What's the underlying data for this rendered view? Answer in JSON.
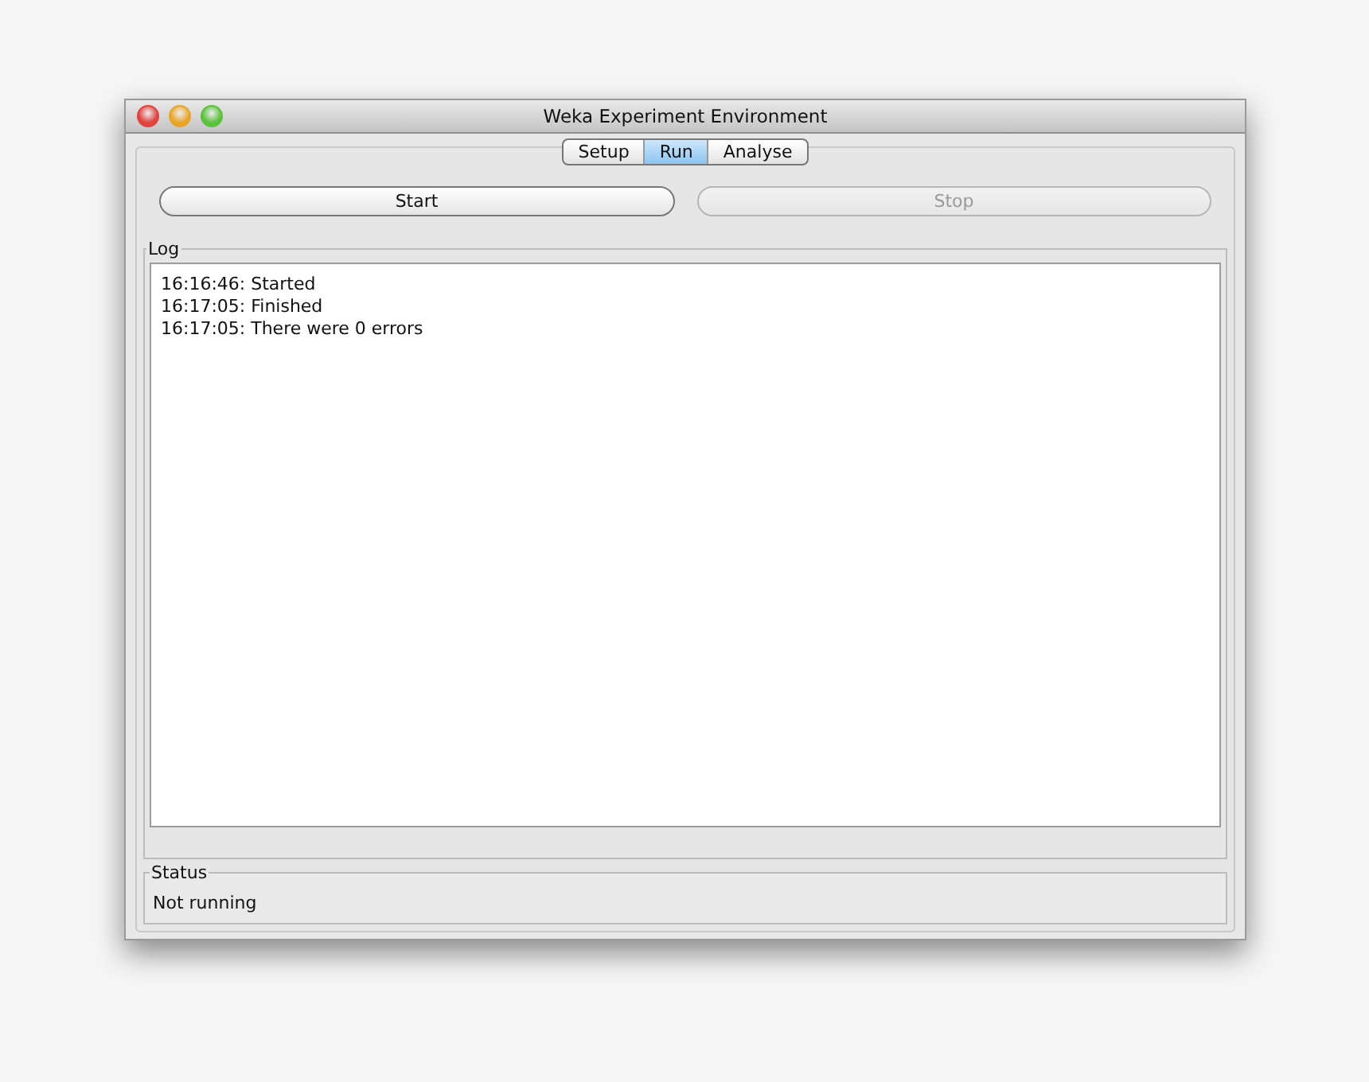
{
  "window": {
    "title": "Weka Experiment Environment"
  },
  "tabs": [
    {
      "label": "Setup",
      "selected": false
    },
    {
      "label": "Run",
      "selected": true
    },
    {
      "label": "Analyse",
      "selected": false
    }
  ],
  "buttons": [
    {
      "label": "Start",
      "disabled": false
    },
    {
      "label": "Stop",
      "disabled": true
    }
  ],
  "log": {
    "title": "Log",
    "lines": [
      "16:16:46: Started",
      "16:17:05: Finished",
      "16:17:05: There were 0 errors"
    ]
  },
  "status": {
    "title": "Status",
    "text": "Not running"
  }
}
